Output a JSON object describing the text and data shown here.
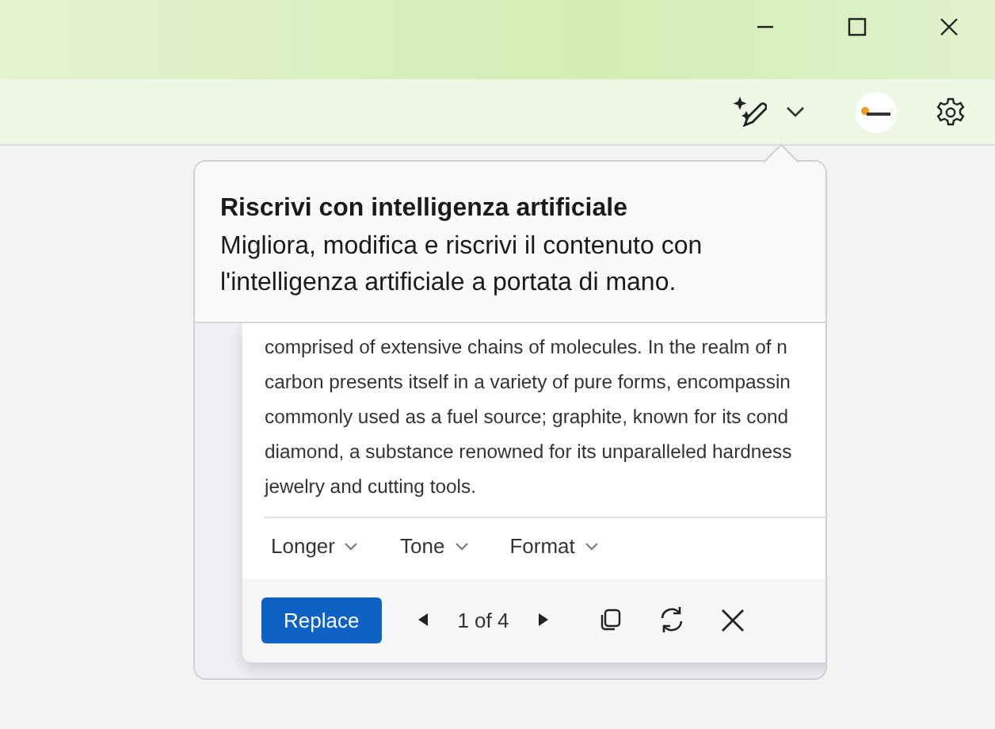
{
  "callout": {
    "title": "Riscrivi con intelligenza artificiale",
    "body": "Migliora, modifica e riscrivi il contenuto con l'intelligenza artificiale a portata di mano."
  },
  "rewrite": {
    "lines": [
      "comprised of extensive chains of molecules. In the realm of n",
      "carbon presents itself in a variety of pure forms, encompassin",
      "commonly used as a fuel source; graphite, known for its cond",
      "diamond, a substance renowned for its unparalleled hardness",
      "jewelry and cutting tools."
    ],
    "options": [
      "Longer",
      "Tone",
      "Format"
    ],
    "primary_button": "Replace",
    "pager": "1 of 4"
  }
}
